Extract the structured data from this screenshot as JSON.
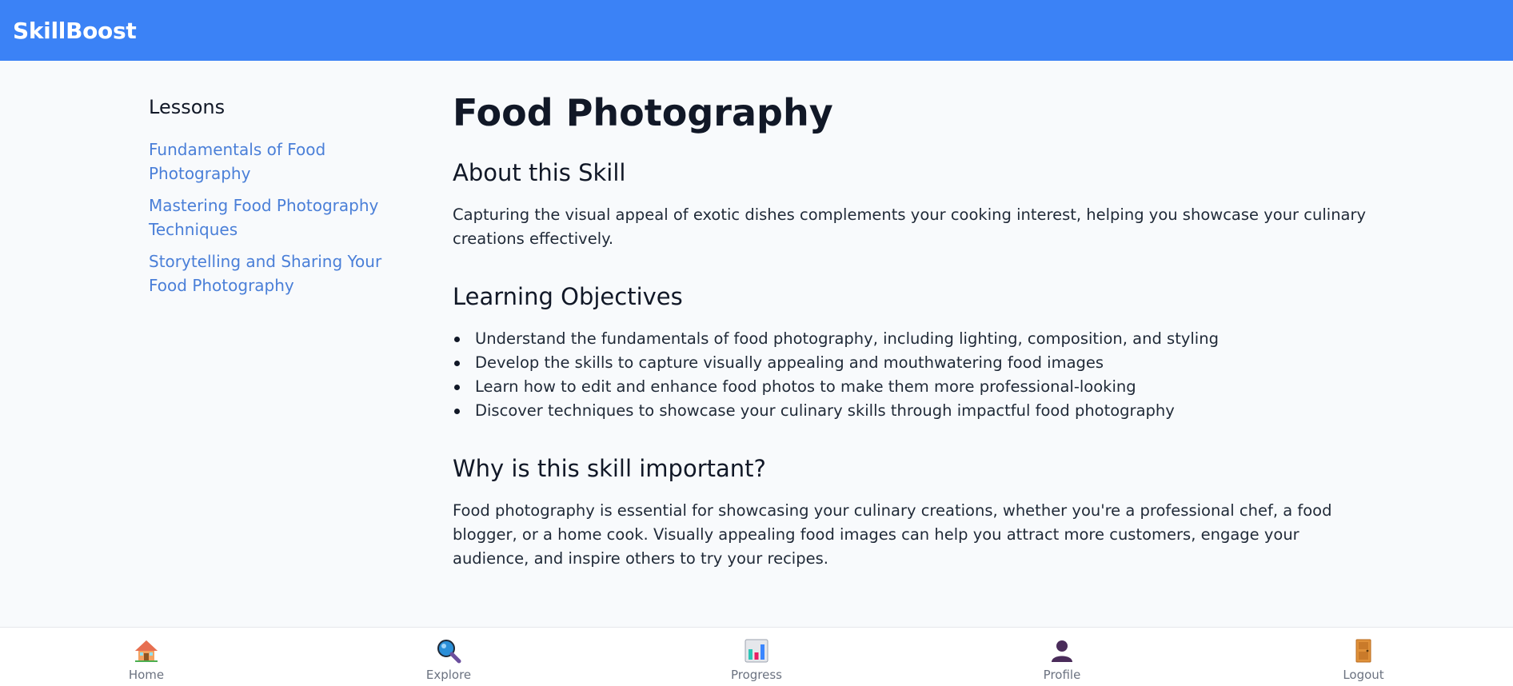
{
  "header": {
    "brand": "SkillBoost"
  },
  "sidebar": {
    "title": "Lessons",
    "lessons": [
      {
        "label": "Fundamentals of Food Photography"
      },
      {
        "label": "Mastering Food Photography Techniques"
      },
      {
        "label": "Storytelling and Sharing Your Food Photography"
      }
    ]
  },
  "main": {
    "title": "Food Photography",
    "about": {
      "heading": "About this Skill",
      "text": "Capturing the visual appeal of exotic dishes complements your cooking interest, helping you showcase your culinary creations effectively."
    },
    "objectives": {
      "heading": "Learning Objectives",
      "items": [
        "Understand the fundamentals of food photography, including lighting, composition, and styling",
        "Develop the skills to capture visually appealing and mouthwatering food images",
        "Learn how to edit and enhance food photos to make them more professional-looking",
        "Discover techniques to showcase your culinary skills through impactful food photography"
      ]
    },
    "importance": {
      "heading": "Why is this skill important?",
      "text": "Food photography is essential for showcasing your culinary creations, whether you're a professional chef, a food blogger, or a home cook. Visually appealing food images can help you attract more customers, engage your audience, and inspire others to try your recipes."
    }
  },
  "bottom_nav": {
    "items": [
      {
        "label": "Home",
        "icon": "house-icon"
      },
      {
        "label": "Explore",
        "icon": "magnifier-icon"
      },
      {
        "label": "Progress",
        "icon": "bar-chart-icon"
      },
      {
        "label": "Profile",
        "icon": "person-icon"
      },
      {
        "label": "Logout",
        "icon": "door-icon"
      }
    ]
  },
  "colors": {
    "header_bg": "#3b82f6",
    "link": "#4a7fd8",
    "page_bg": "#f8fafc"
  }
}
